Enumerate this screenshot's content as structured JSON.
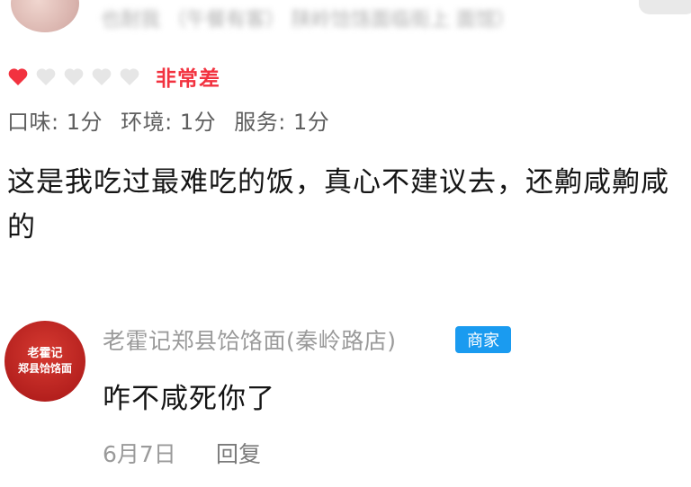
{
  "reviewer": {
    "blurred_name": "也耐我 （午餐有客） 陕岭饸饹面临街上 面馆）"
  },
  "rating": {
    "hearts_filled": 1,
    "hearts_total": 5,
    "filled_color": "#f2323f",
    "empty_color": "#e6e6e6",
    "label": "非常差"
  },
  "scores": {
    "taste": "口味: 1分",
    "environment": "环境: 1分",
    "service": "服务: 1分"
  },
  "review": {
    "text": "这是我吃过最难吃的饭，真心不建议去，还齁咸齁咸的"
  },
  "merchant": {
    "avatar_line1": "老霍记",
    "avatar_line2": "郑县饸饹面",
    "name": "老霍记郑县饸饹面(秦岭路店)",
    "badge": "商家",
    "reply": "咋不咸死你了",
    "date": "6月7日",
    "reply_button": "回复"
  }
}
